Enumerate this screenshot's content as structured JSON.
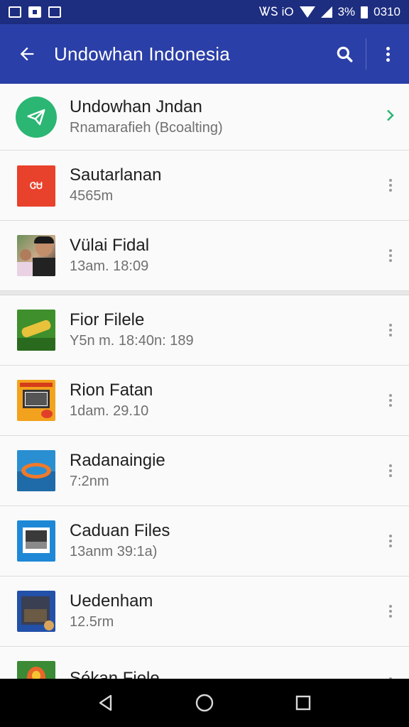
{
  "status_bar": {
    "left_icons": [
      "gallery-icon",
      "clipboard-icon",
      "image-icon"
    ],
    "indicators": "ᏔᏚ iO",
    "battery_text": "3%",
    "time": "0310"
  },
  "app_bar": {
    "title": "Undowhan Indonesia",
    "back_icon": "arrow-back-icon",
    "search_icon": "search-icon",
    "menu_icon": "more-vert-icon"
  },
  "featured": {
    "title": "Undowhan Jndan",
    "subtitle": "Rnamarafieh (Bcoalting)",
    "icon": "send-icon",
    "accent": "#2bb673"
  },
  "items": [
    {
      "title": "Sautarlanan",
      "subtitle": "4565m",
      "thumb": "red-app-thumb"
    },
    {
      "title": "Vülai Fidal",
      "subtitle": "13am. 18:09",
      "thumb": "people-photo-thumb"
    },
    {
      "title": "Fior Filele",
      "subtitle": "Y5n m. 18:40n: 189",
      "thumb": "green-game-thumb"
    },
    {
      "title": "Rion Fatan",
      "subtitle": "1dam. 29.10",
      "thumb": "orange-tv-thumb"
    },
    {
      "title": "Radanaingie",
      "subtitle": "7:2nm",
      "thumb": "blue-logo-thumb"
    },
    {
      "title": "Caduan Files",
      "subtitle": "13anm 39:1a)",
      "thumb": "blue-photo-thumb"
    },
    {
      "title": "Uedenham",
      "subtitle": "12.5rm",
      "thumb": "city-photo-thumb"
    },
    {
      "title": "Sékan Fiele",
      "subtitle": "",
      "thumb": "flower-thumb"
    }
  ],
  "nav_bar": {
    "back": "nav-back-icon",
    "home": "nav-home-icon",
    "recents": "nav-recents-icon"
  },
  "colors": {
    "app_bar": "#2b3fa8",
    "status_bar": "#1d2d80",
    "chevron": "#2bb673"
  }
}
